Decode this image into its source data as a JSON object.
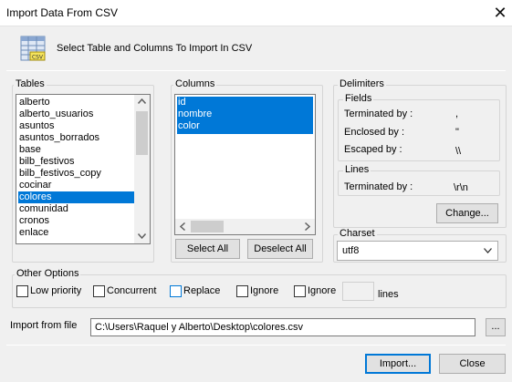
{
  "window": {
    "title": "Import Data From CSV",
    "close_glyph": "✕"
  },
  "header": {
    "text": "Select Table and Columns To Import In CSV",
    "icon": "csv-table-icon"
  },
  "tables": {
    "label": "Tables",
    "items": [
      "alberto",
      "alberto_usuarios",
      "asuntos",
      "asuntos_borrados",
      "base",
      "bilb_festivos",
      "bilb_festivos_copy",
      "cocinar",
      "colores",
      "comunidad",
      "cronos",
      "enlace"
    ],
    "selected": "colores"
  },
  "columns": {
    "label": "Columns",
    "items": [
      "id",
      "nombre",
      "color"
    ],
    "select_all_label": "Select All",
    "deselect_all_label": "Deselect All"
  },
  "delimiters": {
    "label": "Delimiters",
    "fields": {
      "label": "Fields",
      "terminated_by_label": "Terminated by :",
      "terminated_by_value": ",",
      "enclosed_by_label": "Enclosed by :",
      "enclosed_by_value": "\"",
      "escaped_by_label": "Escaped by :",
      "escaped_by_value": "\\\\"
    },
    "lines": {
      "label": "Lines",
      "terminated_by_label": "Terminated by :",
      "terminated_by_value": "\\r\\n"
    },
    "change_label": "Change..."
  },
  "charset": {
    "label": "Charset",
    "value": "utf8"
  },
  "other_options": {
    "label": "Other Options",
    "low_priority": "Low priority",
    "concurrent": "Concurrent",
    "replace": "Replace",
    "ignore1": "Ignore",
    "ignore2": "Ignore",
    "lines_value": "",
    "lines_label": "lines"
  },
  "import_file": {
    "label": "Import from file",
    "path": "C:\\Users\\Raquel y Alberto\\Desktop\\colores.csv",
    "browse_label": "..."
  },
  "footer": {
    "import_label": "Import...",
    "close_label": "Close"
  },
  "colors": {
    "selection": "#0078d7",
    "background": "#f0f0f0"
  }
}
